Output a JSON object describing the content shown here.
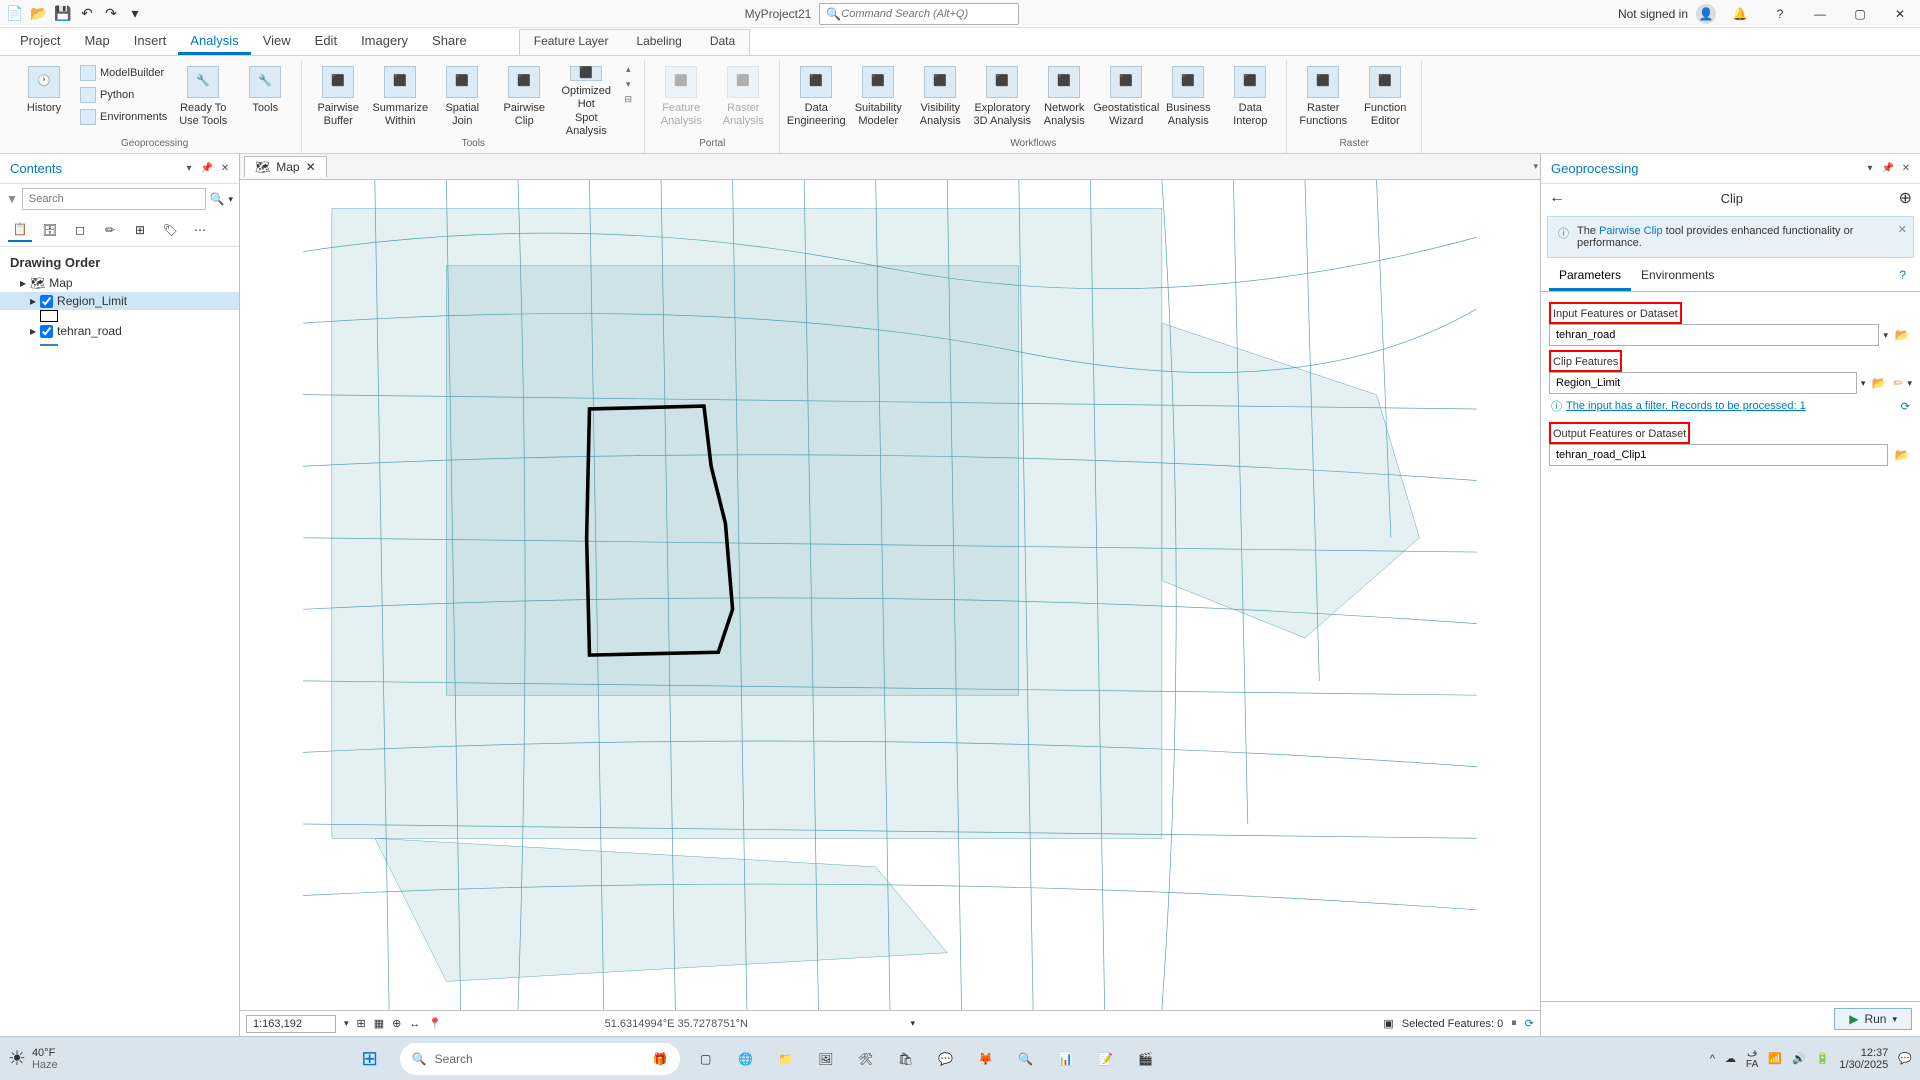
{
  "title": {
    "project": "MyProject21",
    "search_placeholder": "Command Search (Alt+Q)",
    "signin": "Not signed in"
  },
  "menu": {
    "items": [
      "Project",
      "Map",
      "Insert",
      "Analysis",
      "View",
      "Edit",
      "Imagery",
      "Share"
    ],
    "active": "Analysis",
    "sub": [
      "Feature Layer",
      "Labeling",
      "Data"
    ]
  },
  "ribbon": {
    "groups": [
      {
        "label": "Geoprocessing",
        "big": [
          {
            "t": "History"
          },
          {
            "t": "Ready To\nUse Tools"
          },
          {
            "t": "Tools"
          }
        ],
        "small": [
          "ModelBuilder",
          "Python",
          "Environments"
        ]
      },
      {
        "label": "Tools",
        "big": [
          {
            "t": "Pairwise\nBuffer"
          },
          {
            "t": "Summarize\nWithin"
          },
          {
            "t": "Spatial\nJoin"
          },
          {
            "t": "Pairwise\nClip"
          },
          {
            "t": "Optimized Hot\nSpot Analysis"
          }
        ]
      },
      {
        "label": "Portal",
        "big": [
          {
            "t": "Feature\nAnalysis",
            "d": true
          },
          {
            "t": "Raster\nAnalysis",
            "d": true
          }
        ]
      },
      {
        "label": "Workflows",
        "big": [
          {
            "t": "Data\nEngineering"
          },
          {
            "t": "Suitability\nModeler"
          },
          {
            "t": "Visibility\nAnalysis"
          },
          {
            "t": "Exploratory\n3D Analysis"
          },
          {
            "t": "Network\nAnalysis"
          },
          {
            "t": "Geostatistical\nWizard"
          },
          {
            "t": "Business\nAnalysis"
          },
          {
            "t": "Data\nInterop"
          }
        ]
      },
      {
        "label": "Raster",
        "big": [
          {
            "t": "Raster\nFunctions"
          },
          {
            "t": "Function\nEditor"
          }
        ]
      }
    ]
  },
  "contents": {
    "title": "Contents",
    "search_ph": "Search",
    "heading": "Drawing Order",
    "map": "Map",
    "layers": [
      {
        "name": "Region_Limit",
        "checked": true,
        "sel": true
      },
      {
        "name": "tehran_road",
        "checked": true,
        "sel": false
      }
    ]
  },
  "mapview": {
    "tab": "Map",
    "scale": "1:163,192",
    "coord": "51.6314994°E 35.7278751°N",
    "selected": "Selected Features: 0"
  },
  "gp": {
    "title": "Geoprocessing",
    "tool": "Clip",
    "info_pre": "The ",
    "info_link": "Pairwise Clip",
    "info_post": " tool provides enhanced functionality or performance.",
    "tabs": [
      "Parameters",
      "Environments"
    ],
    "active_tab": "Parameters",
    "p1_label": "Input Features or Dataset",
    "p1_val": "tehran_road",
    "p2_label": "Clip Features",
    "p2_val": "Region_Limit",
    "filter_msg": "The input has a filter. Records to be processed: 1",
    "p3_label": "Output Features or Dataset",
    "p3_val": "tehran_road_Clip1",
    "run": "Run"
  },
  "taskbar": {
    "temp": "40°F",
    "cond": "Haze",
    "search": "Search",
    "lang": "FA",
    "time": "12:37",
    "date": "1/30/2025"
  }
}
